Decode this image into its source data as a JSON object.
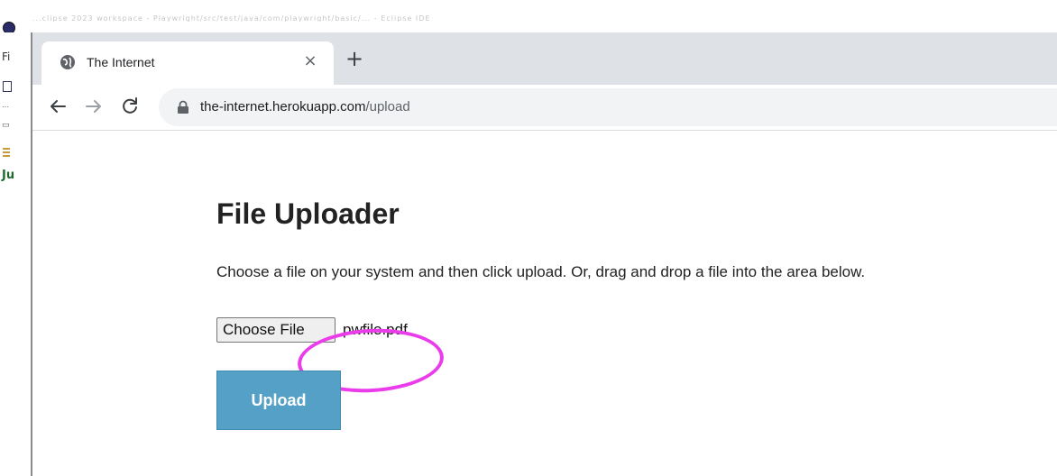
{
  "background_app": {
    "title_text": "...clipse 2023 workspace - Playwright/src/test/java/com/playwright/basic/... - Eclipse IDE",
    "menu_letters": "Fi",
    "panel_label": "Ju"
  },
  "browser": {
    "tab": {
      "title": "The Internet",
      "close_glyph": "×",
      "favicon": "globe-icon"
    },
    "new_tab_glyph": "+",
    "nav": {
      "back": "arrow-left-icon",
      "forward": "arrow-right-icon",
      "reload": "reload-icon"
    },
    "address": {
      "host": "the-internet.herokuapp.com",
      "path": "/upload",
      "lock": "lock-icon"
    }
  },
  "page": {
    "heading": "File Uploader",
    "instructions": "Choose a file on your system and then click upload. Or, drag and drop a file into the area below.",
    "file_input": {
      "button_label": "Choose File",
      "selected_file": "pwfile.pdf"
    },
    "upload_button": "Upload"
  },
  "colors": {
    "upload_button": "#55a0c7",
    "annotation_circle": "#ea3cea",
    "tabstrip": "#dee1e6",
    "omnibox": "#f1f3f4"
  }
}
